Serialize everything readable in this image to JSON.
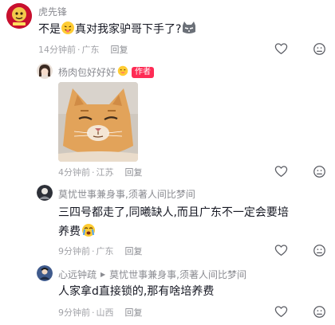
{
  "comments": [
    {
      "username": "虎先锋",
      "text_before": "不是",
      "text_after": "真对我家驴哥下手了?",
      "time": "14分钟前",
      "location": "广东",
      "reply": "回复"
    },
    {
      "username": "杨肉包好好好",
      "author_badge": "作者",
      "time": "4分钟前",
      "location": "江苏",
      "reply": "回复"
    },
    {
      "username": "莫忧世事兼身事,须著人间比梦间",
      "text_line1": "三四号都走了,同曦缺人,而且广东不一定会要培",
      "text_line2": "养费",
      "time": "9分钟前",
      "location": "广东",
      "reply": "回复"
    },
    {
      "username": "心远钟疏",
      "reply_arrow": "▶",
      "reply_to": "莫忧世事兼身事,须著人间比梦间",
      "text": "人家拿d直接锁的,那有啥培养费",
      "time": "9分钟前",
      "location": "山西",
      "reply": "回复"
    }
  ],
  "meta_separator": "·",
  "colors": {
    "accent": "#fe2c55",
    "text": "#161823",
    "secondary": "#8a8b91"
  }
}
